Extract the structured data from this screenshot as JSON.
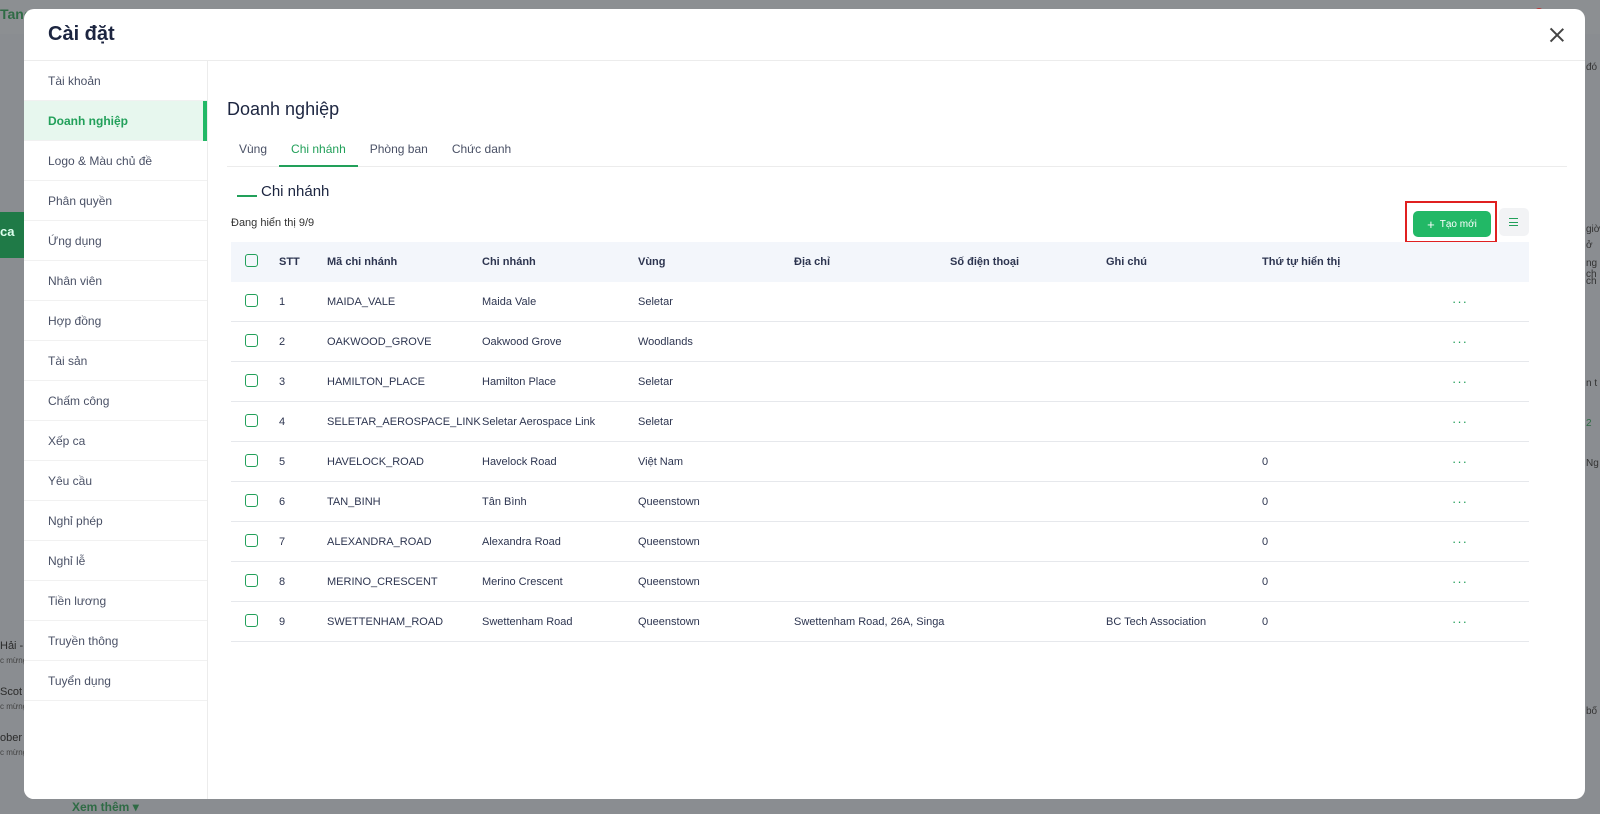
{
  "background": {
    "logo_text": "Tano",
    "green_tab_text": "ca",
    "people": [
      {
        "name": "Hải -",
        "sub": "c mừng"
      },
      {
        "name": "Scot",
        "sub": "c mừng"
      },
      {
        "name": "ober",
        "sub": "c mừng"
      }
    ],
    "see_more_label": "Xem thêm",
    "right_fragments": [
      "đó",
      "giờ",
      "ở",
      "ng ch",
      "ch",
      "n t",
      "2",
      "Ng",
      "bố"
    ]
  },
  "modal": {
    "title": "Cài đặt",
    "close_icon": "close-icon"
  },
  "sidebar": {
    "items": [
      {
        "label": "Tài khoản"
      },
      {
        "label": "Doanh nghiệp",
        "active": true
      },
      {
        "label": "Logo & Màu chủ đề"
      },
      {
        "label": "Phân quyền"
      },
      {
        "label": "Ứng dụng"
      },
      {
        "label": "Nhân viên"
      },
      {
        "label": "Hợp đồng"
      },
      {
        "label": "Tài sản"
      },
      {
        "label": "Chấm công"
      },
      {
        "label": "Xếp ca"
      },
      {
        "label": "Yêu cầu"
      },
      {
        "label": "Nghỉ phép"
      },
      {
        "label": "Nghỉ lễ"
      },
      {
        "label": "Tiền lương"
      },
      {
        "label": "Truyền thông"
      },
      {
        "label": "Tuyển dụng"
      }
    ]
  },
  "main": {
    "page_title": "Doanh nghiệp",
    "tabs": [
      {
        "label": "Vùng"
      },
      {
        "label": "Chi nhánh",
        "active": true
      },
      {
        "label": "Phòng ban"
      },
      {
        "label": "Chức danh"
      }
    ],
    "section_title": "Chi nhánh",
    "count_text": "Đang hiển thị 9/9",
    "create_button": {
      "label": "Tạo mới",
      "icon": "plus-icon"
    },
    "view_menu_icon": "list-menu-icon",
    "accent_color": "#22b866",
    "highlight_color": "#e02020"
  },
  "table": {
    "headers": [
      "STT",
      "Mã chi nhánh",
      "Chi nhánh",
      "Vùng",
      "Địa chỉ",
      "Số điện thoại",
      "Ghi chú",
      "Thứ tự hiển thị"
    ],
    "rows": [
      {
        "stt": "1",
        "code": "MAIDA_VALE",
        "name": "Maida Vale",
        "region": "Seletar",
        "address": "",
        "phone": "",
        "note": "",
        "order": ""
      },
      {
        "stt": "2",
        "code": "OAKWOOD_GROVE",
        "name": "Oakwood Grove",
        "region": "Woodlands",
        "address": "",
        "phone": "",
        "note": "",
        "order": ""
      },
      {
        "stt": "3",
        "code": "HAMILTON_PLACE",
        "name": "Hamilton Place",
        "region": "Seletar",
        "address": "",
        "phone": "",
        "note": "",
        "order": ""
      },
      {
        "stt": "4",
        "code": "SELETAR_AEROSPACE_LINK",
        "name": "Seletar Aerospace Link",
        "region": "Seletar",
        "address": "",
        "phone": "",
        "note": "",
        "order": ""
      },
      {
        "stt": "5",
        "code": "HAVELOCK_ROAD",
        "name": "Havelock Road",
        "region": "Việt Nam",
        "address": "",
        "phone": "",
        "note": "",
        "order": "0"
      },
      {
        "stt": "6",
        "code": "TAN_BINH",
        "name": "Tân Bình",
        "region": "Queenstown",
        "address": "",
        "phone": "",
        "note": "",
        "order": "0"
      },
      {
        "stt": "7",
        "code": "ALEXANDRA_ROAD",
        "name": "Alexandra Road",
        "region": "Queenstown",
        "address": "",
        "phone": "",
        "note": "",
        "order": "0"
      },
      {
        "stt": "8",
        "code": "MERINO_CRESCENT",
        "name": "Merino Crescent",
        "region": "Queenstown",
        "address": "",
        "phone": "",
        "note": "",
        "order": "0"
      },
      {
        "stt": "9",
        "code": "SWETTENHAM_ROAD",
        "name": "Swettenham Road",
        "region": "Queenstown",
        "address": "Swettenham Road, 26A, Singa",
        "phone": "",
        "note": "BC Tech Association",
        "order": "0"
      }
    ],
    "row_action_label": "···"
  }
}
